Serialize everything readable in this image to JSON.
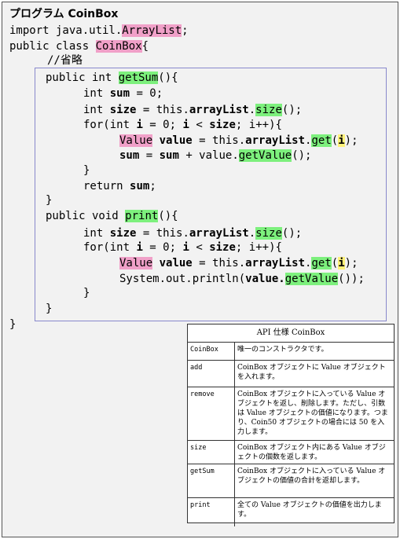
{
  "title": "プログラム CoinBox",
  "code": {
    "import_kw": "import java.util.",
    "import_class": "ArrayList",
    "import_end": ";",
    "class_decl": "public class ",
    "class_name": "CoinBox",
    "brace_open": "{",
    "comment": "//省略",
    "getsum_decl": "public int ",
    "getsum_name": "getSum",
    "paren_brace": "(){",
    "int_kw": "int ",
    "sum": "sum",
    "eq_zero": " = 0;",
    "size": "size",
    "eq_this": " = this.",
    "arraylist": "arrayList",
    "dot": ".",
    "size_method": "size",
    "call_end": "();",
    "for_open": "for(int ",
    "i": "i",
    "eq_0_semi": " = 0; ",
    "lt": " < ",
    "semi_inc": "; ",
    "inc": "i++",
    "loop_open": "){",
    "value_type": "Value",
    "value_var": " value",
    "get_method": "get",
    "paren_open": "(",
    "paren_close": ");",
    "sum_eq": " = ",
    "plus_value": " + value.",
    "getvalue_method": "getValue",
    "close_brace": "}",
    "return_kw": "return ",
    "semi": ";",
    "print_decl": "public void ",
    "print_name": "print",
    "println": "System.out.println(",
    "value_dot": "value.",
    "println_end": "());",
    "final_brace": "}"
  },
  "api": {
    "title": "API 仕様 CoinBox",
    "rows": [
      {
        "name": "CoinBox",
        "desc": "唯一のコンストラクタです。"
      },
      {
        "name": "add",
        "desc": "CoinBox オブジェクトに Value オブジェクトを入れます。"
      },
      {
        "name": "remove",
        "desc": "CoinBox オブジェクトに入っている Value オブジェクトを返し、削除します。ただし、引数は Value オブジェクトの価値になります。つまり、Coin50 オブジェクトの場合には 50 を入力します。"
      },
      {
        "name": "size",
        "desc": "CoinBox オブジェクト内にある Value オブジェクトの個数を返します。"
      },
      {
        "name": "getSum",
        "desc": "CoinBox オブジェクトに入っている Value オブジェクトの価値の合計を返却します。"
      },
      {
        "name": "print",
        "desc": "全ての Value オブジェクトの価値を出力します。"
      }
    ]
  }
}
